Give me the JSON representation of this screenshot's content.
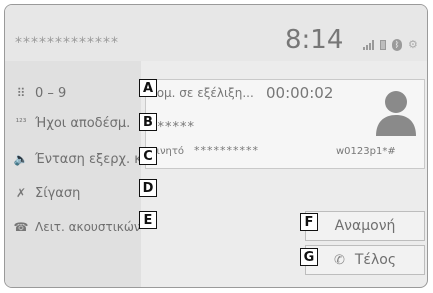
{
  "status_bar": {
    "masked_text": "*************",
    "time": "8:14"
  },
  "icons": {
    "signal": "signal-bars-icon",
    "battery": "battery-icon",
    "bluetooth": "bluetooth-icon",
    "settings": "settings-icon",
    "keypad": "keypad-icon",
    "touch_tones": "touch-tones-icon",
    "volume": "speaker-icon",
    "mute": "mute-mic-icon",
    "handset": "handset-icon",
    "contact": "contact-avatar-icon",
    "phone": "phone-icon"
  },
  "sidebar": {
    "items": [
      {
        "label": "0 – 9",
        "icon": "keypad-icon"
      },
      {
        "label": "Ήχοι αποδέσμ.",
        "icon": "touch-tones-icon"
      },
      {
        "label": "Ένταση εξερχ. κλ.",
        "icon": "speaker-icon"
      },
      {
        "label": "Σίγαση",
        "icon": "mute-mic-icon"
      },
      {
        "label": "Λειτ. ακουστικών",
        "icon": "handset-icon"
      }
    ]
  },
  "call": {
    "status": "νομ. σε εξέλιξη...",
    "duration": "00:00:02",
    "hidden_name": "******",
    "phone_type": "Κινητό",
    "phone_number": "**********",
    "phone_code": "w0123p1*#"
  },
  "buttons": {
    "hold": "Αναμονή",
    "end": "Τέλος"
  },
  "callouts": {
    "A": "A",
    "B": "B",
    "C": "C",
    "D": "D",
    "E": "E",
    "F": "F",
    "G": "G"
  }
}
